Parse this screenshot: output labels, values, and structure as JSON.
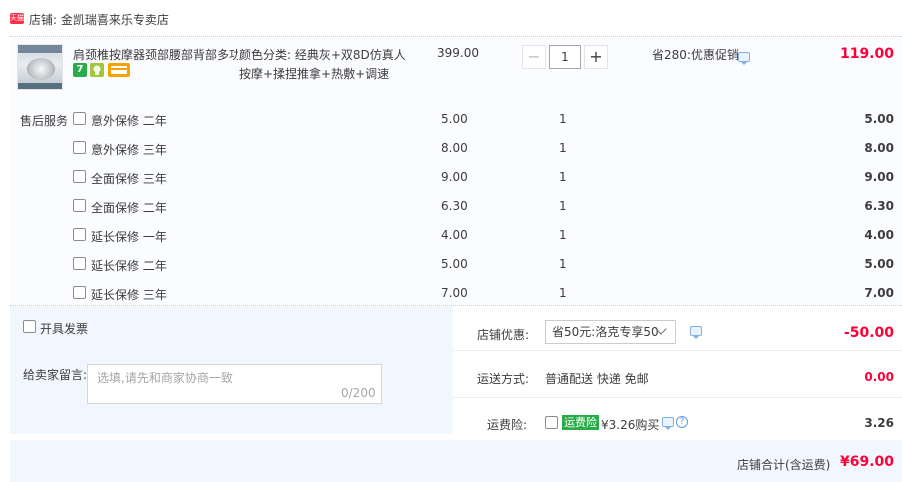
{
  "shop": {
    "badge": "天猫",
    "name": "店铺: 金凯瑞喜来乐专卖店"
  },
  "item": {
    "title": "肩颈椎按摩器颈部腰部背部多功...",
    "badges": [
      "7",
      "",
      ""
    ],
    "sku_line1": "颜色分类: 经典灰+双8D仿真人",
    "sku_line2": "按摩+揉捏推拿+热敷+调速",
    "unit_price": "399.00",
    "qty_minus": "−",
    "qty": "1",
    "qty_plus": "+",
    "discount": "省280:优惠促销",
    "total": "119.00"
  },
  "services": {
    "title": "售后服务",
    "rows": [
      {
        "name": "意外保修 二年",
        "price": "5.00",
        "qty": "1",
        "sum": "5.00"
      },
      {
        "name": "意外保修 三年",
        "price": "8.00",
        "qty": "1",
        "sum": "8.00"
      },
      {
        "name": "全面保修 三年",
        "price": "9.00",
        "qty": "1",
        "sum": "9.00"
      },
      {
        "name": "全面保修 二年",
        "price": "6.30",
        "qty": "1",
        "sum": "6.30"
      },
      {
        "name": "延长保修 一年",
        "price": "4.00",
        "qty": "1",
        "sum": "4.00"
      },
      {
        "name": "延长保修 二年",
        "price": "5.00",
        "qty": "1",
        "sum": "5.00"
      },
      {
        "name": "延长保修 三年",
        "price": "7.00",
        "qty": "1",
        "sum": "7.00"
      }
    ]
  },
  "invoice": {
    "label": "开具发票"
  },
  "message": {
    "label": "给卖家留言:",
    "placeholder": "选填,请先和商家协商一致",
    "count": "0/200"
  },
  "coupon": {
    "label": "店铺优惠:",
    "selected": "省50元:洛克专享50",
    "amount": "-50.00"
  },
  "shipping": {
    "label": "运送方式:",
    "value": "普通配送 快递 免邮",
    "fee": "0.00"
  },
  "insurance": {
    "label": "运费险:",
    "tag": "运费险",
    "text": "¥3.26购买",
    "help": "?",
    "fee": "3.26"
  },
  "summary": {
    "label": "店铺合计(含运费)",
    "total": "¥69.00"
  },
  "colors": {
    "accent_red": "#ff0036",
    "tag_green": "#2aab49",
    "panel_blue": "#f2f7ff"
  }
}
